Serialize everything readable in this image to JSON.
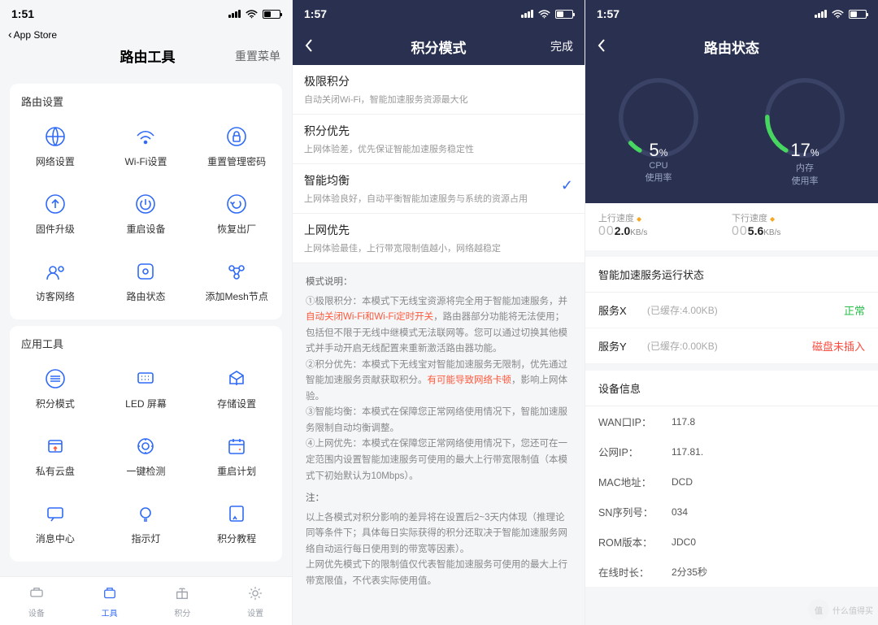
{
  "screen1": {
    "time": "1:51",
    "back": "App Store",
    "title": "路由工具",
    "reset": "重置菜单",
    "section1": {
      "title": "路由设置",
      "items": [
        {
          "icon": "globe",
          "label": "网络设置"
        },
        {
          "icon": "wifi",
          "label": "Wi-Fi设置"
        },
        {
          "icon": "lock",
          "label": "重置管理密码"
        },
        {
          "icon": "upgrade",
          "label": "固件升级"
        },
        {
          "icon": "power",
          "label": "重启设备"
        },
        {
          "icon": "factory",
          "label": "恢复出厂"
        },
        {
          "icon": "guest",
          "label": "访客网络"
        },
        {
          "icon": "status",
          "label": "路由状态"
        },
        {
          "icon": "mesh",
          "label": "添加Mesh节点"
        }
      ]
    },
    "section2": {
      "title": "应用工具",
      "items": [
        {
          "icon": "points",
          "label": "积分模式"
        },
        {
          "icon": "led",
          "label": "LED 屏幕"
        },
        {
          "icon": "storage",
          "label": "存储设置"
        },
        {
          "icon": "cloud",
          "label": "私有云盘"
        },
        {
          "icon": "scan",
          "label": "一键检测"
        },
        {
          "icon": "schedule",
          "label": "重启计划"
        },
        {
          "icon": "msg",
          "label": "消息中心"
        },
        {
          "icon": "light",
          "label": "指示灯"
        },
        {
          "icon": "tutorial",
          "label": "积分教程"
        }
      ]
    },
    "tabs": [
      {
        "icon": "device",
        "label": "设备"
      },
      {
        "icon": "tools",
        "label": "工具"
      },
      {
        "icon": "gift",
        "label": "积分"
      },
      {
        "icon": "gear",
        "label": "设置"
      }
    ],
    "active_tab": 1
  },
  "screen2": {
    "time": "1:57",
    "title": "积分模式",
    "done": "完成",
    "options": [
      {
        "title": "极限积分",
        "desc": "自动关闭Wi-Fi，智能加速服务资源最大化",
        "selected": false
      },
      {
        "title": "积分优先",
        "desc": "上网体验差，优先保证智能加速服务稳定性",
        "selected": false
      },
      {
        "title": "智能均衡",
        "desc": "上网体验良好，自动平衡智能加速服务与系统的资源占用",
        "selected": true
      },
      {
        "title": "上网优先",
        "desc": "上网体验最佳，上行带宽限制值越小，网络越稳定",
        "selected": false
      }
    ],
    "desc_head": "模式说明：",
    "desc1_a": "①极限积分：本模式下无线宝资源将完全用于智能加速服务，并",
    "desc1_red": "自动关闭Wi-Fi和Wi-Fi定时开关",
    "desc1_b": "，路由器部分功能将无法使用；包括但不限于无线中继模式无法联网等。您可以通过切换其他模式并手动开启无线配置来重新激活路由器功能。",
    "desc2_a": "②积分优先：本模式下无线宝对智能加速服务无限制，优先通过智能加速服务贡献获取积分。",
    "desc2_red": "有可能导致网络卡顿",
    "desc2_b": "，影响上网体验。",
    "desc3": "③智能均衡：本模式在保障您正常网络使用情况下，智能加速服务限制自动均衡调整。",
    "desc4": "④上网优先：本模式在保障您正常网络使用情况下，您还可在一定范围内设置智能加速服务可使用的最大上行带宽限制值（本模式下初始默认为10Mbps）。",
    "note_head": "注：",
    "note1": "以上各模式对积分影响的差异将在设置后2~3天内体现（推理论同等条件下；具体每日实际获得的积分还取决于智能加速服务网络自动运行每日使用到的带宽等因素）。",
    "note2": "上网优先模式下的限制值仅代表智能加速服务可使用的最大上行带宽限值，不代表实际使用值。"
  },
  "screen3": {
    "time": "1:57",
    "title": "路由状态",
    "cpu": {
      "value": "5",
      "unit": "%",
      "label1": "CPU",
      "label2": "使用率",
      "pct": 5
    },
    "mem": {
      "value": "17",
      "unit": "%",
      "label1": "内存",
      "label2": "使用率",
      "pct": 17
    },
    "up": {
      "label": "上行速度",
      "thin": "00",
      "val": "2.0",
      "unit": "KB/s"
    },
    "down": {
      "label": "下行速度",
      "thin": "00",
      "val": "5.6",
      "unit": "KB/s"
    },
    "svc_title": "智能加速服务运行状态",
    "services": [
      {
        "name": "服务X",
        "cache": "(已缓存:4.00KB)",
        "status": "正常",
        "cls": "green"
      },
      {
        "name": "服务Y",
        "cache": "(已缓存:0.00KB)",
        "status": "磁盘未插入",
        "cls": "redtxt"
      }
    ],
    "info_title": "设备信息",
    "info": [
      {
        "k": "WAN口IP：",
        "v": "117.8"
      },
      {
        "k": "公网IP：",
        "v": "117.81."
      },
      {
        "k": "MAC地址：",
        "v": "DCD"
      },
      {
        "k": "SN序列号：",
        "v": "034"
      },
      {
        "k": "ROM版本：",
        "v": "JDC0"
      },
      {
        "k": "在线时长：",
        "v": "2分35秒"
      }
    ]
  },
  "watermark": "什么值得买"
}
